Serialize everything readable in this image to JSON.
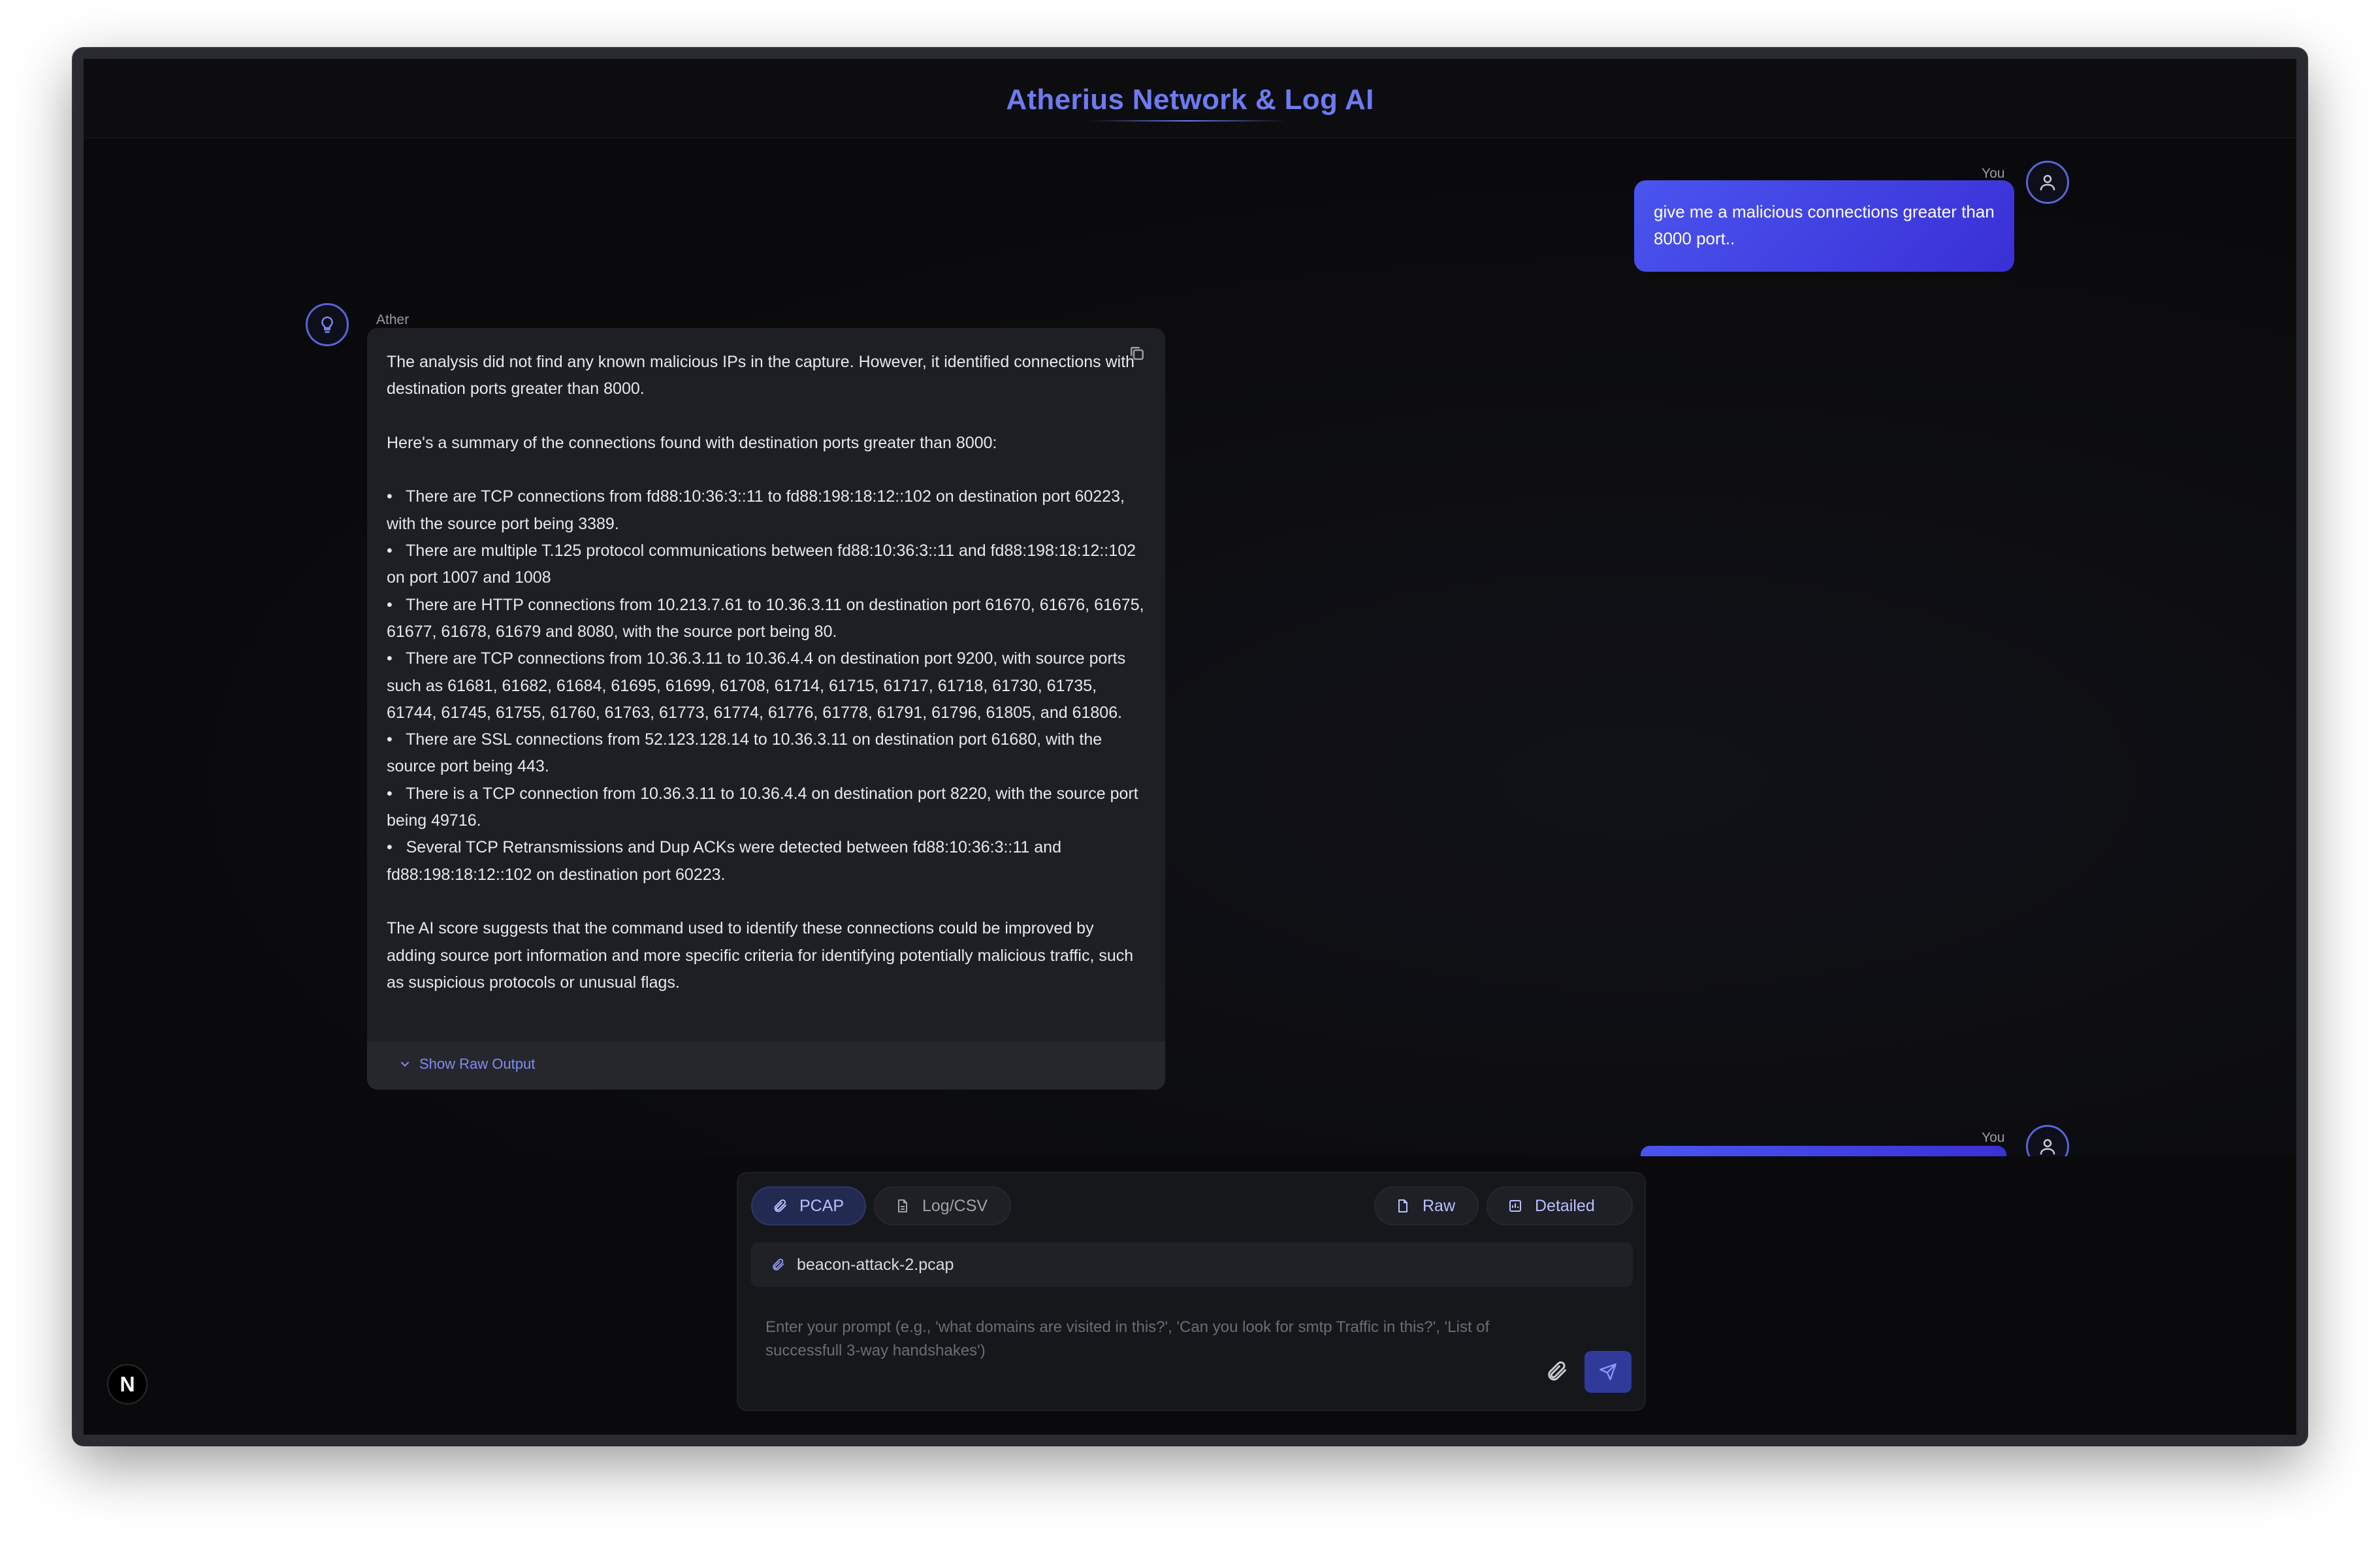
{
  "header": {
    "title": "Atherius Network & Log AI"
  },
  "messages": {
    "user1": {
      "sender": "You",
      "text": "give me a malicious connections greater than 8000 port.."
    },
    "ai": {
      "sender": "Ather",
      "intro": "The analysis did not find any known malicious IPs in the capture. However, it identified connections with destination ports greater than 8000.",
      "summary": "Here's a summary of the connections found with destination ports greater than 8000:",
      "bullets": [
        "There are TCP connections from fd88:10:36:3::11 to fd88:198:18:12::102 on destination port 60223, with the source port being 3389.",
        "There are multiple T.125 protocol communications between fd88:10:36:3::11 and fd88:198:18:12::102 on port 1007 and 1008",
        "There are HTTP connections from 10.213.7.61 to 10.36.3.11 on destination port 61670, 61676, 61675, 61677, 61678, 61679 and 8080, with the source port being 80.",
        "There are TCP connections from 10.36.3.11 to 10.36.4.4 on destination port 9200, with source ports such as 61681, 61682, 61684, 61695, 61699, 61708, 61714, 61715, 61717, 61718, 61730, 61735, 61744, 61745, 61755, 61760, 61763, 61773, 61774, 61776, 61778, 61791, 61796, 61805, and 61806.",
        "There are SSL connections from 52.123.128.14 to 10.36.3.11 on destination port 61680, with the source port being 443.",
        "There is a TCP connection from 10.36.3.11 to 10.36.4.4 on destination port 8220, with the source port being 49716.",
        "Several TCP Retransmissions and Dup ACKs were detected between fd88:10:36:3::11 and fd88:198:18:12::102 on destination port 60223."
      ],
      "conclusion": "The AI score suggests that the command used to identify these connections could be improved by adding source port information and more specific criteria for identifying potentially malicious traffic, such as suspicious protocols or unusual flags.",
      "raw_toggle": "Show Raw Output",
      "bullet_char": "•"
    },
    "user2": {
      "sender": "You"
    }
  },
  "composer": {
    "mode_pcap": "PCAP",
    "mode_log": "Log/CSV",
    "view_raw": "Raw",
    "view_detailed": "Detailed",
    "attached_file": "beacon-attack-2.pcap",
    "placeholder": "Enter your prompt (e.g., 'what domains are visited in this?', 'Can you look for smtp Traffic in this?', 'List of successfull 3-way handshakes')"
  },
  "badge": {
    "letter": "N"
  },
  "colors": {
    "accent": "#6d7bf0",
    "bubble_start": "#4a55ee",
    "bubble_end": "#3a2fd6",
    "background": "#0a0a0c"
  }
}
